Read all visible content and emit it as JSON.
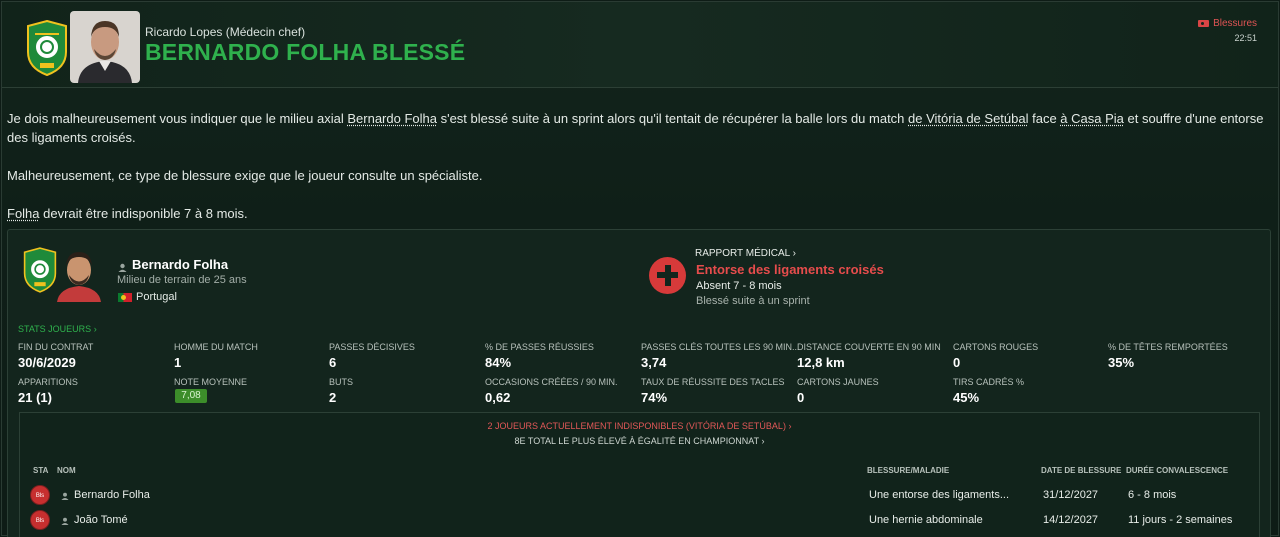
{
  "header": {
    "sender_name": "Ricardo Lopes",
    "sender_role": "(Médecin chef)",
    "title": "BERNARDO FOLHA BLESSÉ",
    "tag": "Blessures",
    "time": "22:51"
  },
  "message": {
    "p1_a": "Je dois malheureusement vous indiquer que le milieu axial ",
    "p1_player": "Bernardo Folha",
    "p1_b": " s'est blessé suite à un sprint alors qu'il tentait de récupérer la balle lors du match ",
    "p1_team1": "de Vitória de Setúbal",
    "p1_c": " face ",
    "p1_team2": "à Casa Pia",
    "p1_d": " et souffre d'une entorse des ligaments croisés.",
    "p2": "Malheureusement, ce type de blessure exige que le joueur consulte un spécialiste.",
    "p3_player": "Folha",
    "p3_rest": " devrait être indisponible 7 à 8 mois."
  },
  "player": {
    "name": "Bernardo Folha",
    "description": "Milieu de terrain de 25 ans",
    "nationality": "Portugal"
  },
  "medical": {
    "heading": "RAPPORT MÉDICAL",
    "injury": "Entorse des ligaments croisés",
    "absence": "Absent 7 - 8 mois",
    "cause": "Blessé suite à un sprint"
  },
  "stats": {
    "link": "STATS JOUEURS",
    "items": [
      {
        "label": "FIN DU CONTRAT",
        "value": "30/6/2029"
      },
      {
        "label": "HOMME DU MATCH",
        "value": "1"
      },
      {
        "label": "PASSES DÉCISIVES",
        "value": "6"
      },
      {
        "label": "% DE PASSES RÉUSSIES",
        "value": "84%"
      },
      {
        "label": "PASSES CLÉS TOUTES LES 90 MIN...",
        "value": "3,74"
      },
      {
        "label": "DISTANCE COUVERTE EN 90 MIN",
        "value": "12,8 km"
      },
      {
        "label": "CARTONS ROUGES",
        "value": "0"
      },
      {
        "label": "% DE TÊTES REMPORTÉES",
        "value": "35%"
      },
      {
        "label": "APPARITIONS",
        "value": "21 (1)"
      },
      {
        "label": "NOTE MOYENNE",
        "value": "7,08"
      },
      {
        "label": "BUTS",
        "value": "2"
      },
      {
        "label": "OCCASIONS CRÉÉES / 90 MIN.",
        "value": "0,62"
      },
      {
        "label": "TAUX DE RÉUSSITE DES TACLES",
        "value": "74%"
      },
      {
        "label": "CARTONS JAUNES",
        "value": "0"
      },
      {
        "label": "TIRS CADRÉS %",
        "value": "45%"
      }
    ]
  },
  "unavailable": {
    "heading": "2 JOUEURS ACTUELLEMENT INDISPONIBLES (VITÓRIA DE SETÚBAL)",
    "subheading": "8E TOTAL LE PLUS ÉLEVÉ À ÉGALITÉ EN CHAMPIONNAT",
    "columns": {
      "sta": "STA",
      "nom": "NOM",
      "injury": "BLESSURE/MALADIE",
      "date": "DATE DE BLESSURE",
      "duration": "DURÉE CONVALESCENCE"
    },
    "rows": [
      {
        "status": "Bls",
        "name": "Bernardo Folha",
        "injury": "Une entorse des ligaments...",
        "date": "31/12/2027",
        "duration": "6 - 8 mois"
      },
      {
        "status": "Bls",
        "name": "João Tomé",
        "injury": "Une hernie abdominale",
        "date": "14/12/2027",
        "duration": "11 jours - 2 semaines"
      }
    ]
  },
  "colors": {
    "accent": "#2fb14d",
    "danger": "#e64c4c",
    "background": "#0e1c16"
  }
}
